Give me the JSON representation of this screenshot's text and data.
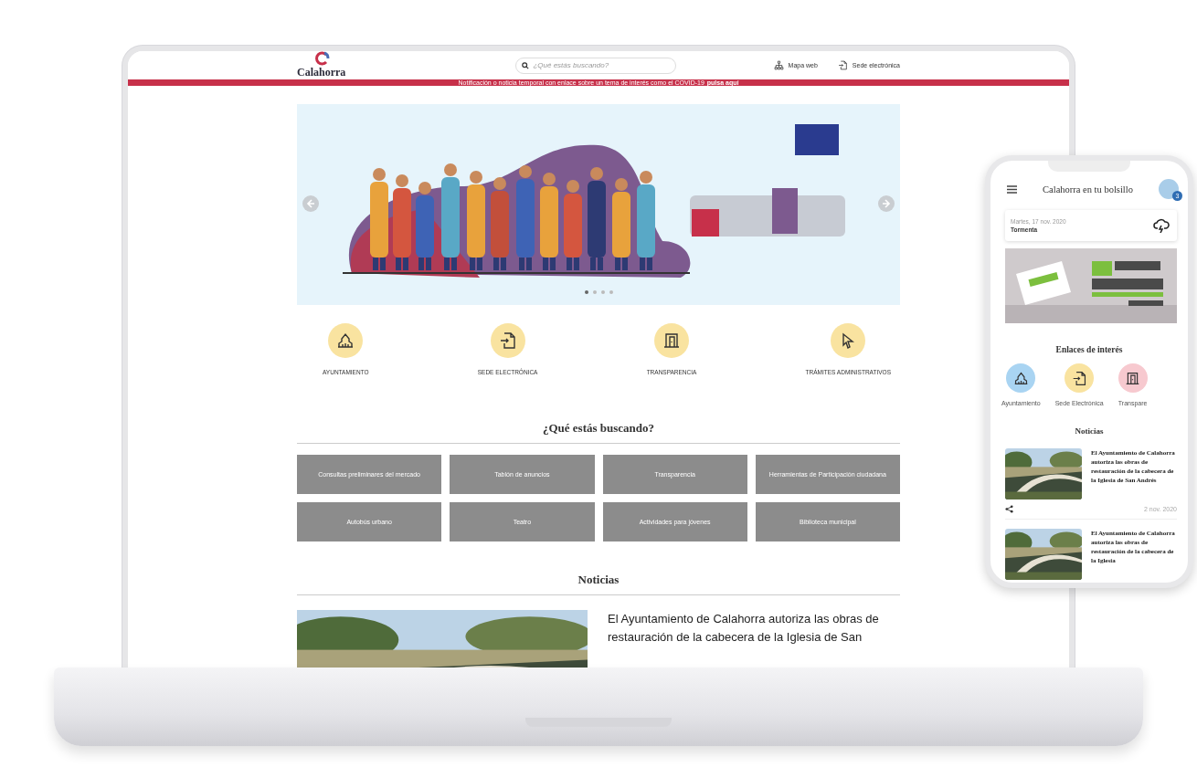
{
  "header": {
    "logo": "Calahorra",
    "search": {
      "placeholder": "¿Qué estás buscando?"
    },
    "links": [
      {
        "label": "Mapa web",
        "kind": "sitemap"
      },
      {
        "label": "Sede electrónica",
        "kind": "document"
      }
    ]
  },
  "notification": {
    "text": "Notificación o noticia temporal con enlace sobre un tema de interés como el COVID-19",
    "link": "pulsa aquí"
  },
  "carousel": {
    "slides": [
      {
        "selected": true
      },
      {
        "selected": false
      },
      {
        "selected": false
      },
      {
        "selected": false
      }
    ]
  },
  "quick_links": [
    {
      "label": "AYUNTAMIENTO",
      "kind": "building"
    },
    {
      "label": "SEDE ELECTRÓNICA",
      "kind": "document"
    },
    {
      "label": "TRANSPARENCIA",
      "kind": "doors"
    },
    {
      "label": "TRÁMITES ADMINISTRATIVOS",
      "kind": "cursor"
    }
  ],
  "search_section": {
    "title": "¿Qué estás buscando?",
    "items": [
      "Consultas preliminares del mercado",
      "Tablón de anuncios",
      "Transparencia",
      "Herramientas de Participación ciudadana",
      "Autobús urbano",
      "Teatro",
      "Actividades para jóvenes",
      "Biblioteca municipal"
    ]
  },
  "news_section": {
    "title": "Noticias",
    "items": [
      {
        "headline": "El Ayuntamiento de Calahorra autoriza las obras de restauración de la cabecera de la Iglesia de San"
      }
    ]
  },
  "phone": {
    "title": "Calahorra en tu bolsillo",
    "badge": "3",
    "weather": {
      "date": "Martes, 17 nov. 2020",
      "condition": "Tormenta"
    },
    "links_title": "Enlaces de interés",
    "links": [
      {
        "label": "Ayuntamiento",
        "kind": "building",
        "color": "#a9d4f2"
      },
      {
        "label": "Sede Electrónica",
        "kind": "document",
        "color": "#f9e3a0"
      },
      {
        "label": "Transpare",
        "kind": "doors",
        "color": "#f7c9cf"
      }
    ],
    "news_title": "Noticias",
    "news": [
      {
        "headline": "El Ayuntamiento de Calahorra autoriza las obras de restauración de la cabecera de la Iglesia de San Andrés",
        "date": "2 nov. 2020"
      },
      {
        "headline": "El Ayuntamiento de Calahorra autoriza las obras de restauración de la cabecera de la Iglesia"
      }
    ]
  }
}
